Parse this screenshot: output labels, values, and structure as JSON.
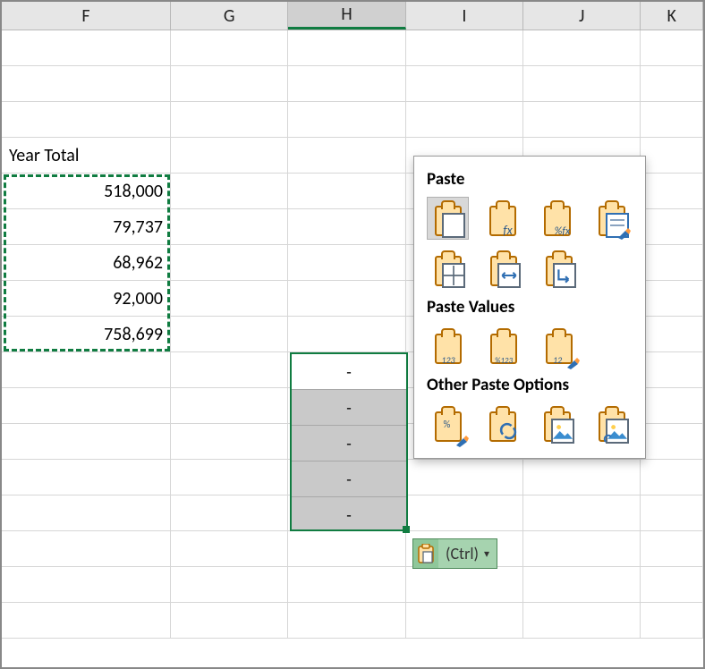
{
  "columns": [
    "F",
    "G",
    "H",
    "I",
    "J",
    "K"
  ],
  "active_column": "H",
  "f_column": {
    "header_text": "Year Total",
    "values": [
      "518,000",
      "79,737",
      "68,962",
      "92,000",
      "758,699"
    ]
  },
  "paste_dest": {
    "column": "H",
    "display_values": [
      "-",
      "-",
      "-",
      "-",
      "-"
    ]
  },
  "smart_tag": {
    "label": "(Ctrl)",
    "icon": "clipboard-icon",
    "caret": "▾"
  },
  "flyout": {
    "paste_title": "Paste",
    "paste_values_title": "Paste Values",
    "other_title": "Other Paste Options",
    "paste_icons": [
      {
        "name": "paste-all-icon",
        "label": ""
      },
      {
        "name": "paste-formulas-icon",
        "label": "fx"
      },
      {
        "name": "paste-formulas-number-fmt-icon",
        "label": "%fx"
      },
      {
        "name": "paste-keep-source-fmt-icon",
        "label": ""
      },
      {
        "name": "paste-no-borders-icon",
        "label": ""
      },
      {
        "name": "paste-keep-col-width-icon",
        "label": ""
      },
      {
        "name": "paste-transpose-icon",
        "label": ""
      }
    ],
    "values_icons": [
      {
        "name": "paste-values-icon",
        "label": "123"
      },
      {
        "name": "paste-values-number-fmt-icon",
        "label": "%123"
      },
      {
        "name": "paste-values-source-fmt-icon",
        "label": "12"
      }
    ],
    "other_icons": [
      {
        "name": "paste-formatting-icon",
        "label": "%"
      },
      {
        "name": "paste-link-icon",
        "label": ""
      },
      {
        "name": "paste-picture-icon",
        "label": ""
      },
      {
        "name": "paste-linked-picture-icon",
        "label": ""
      }
    ],
    "selected": "paste-all-icon"
  }
}
